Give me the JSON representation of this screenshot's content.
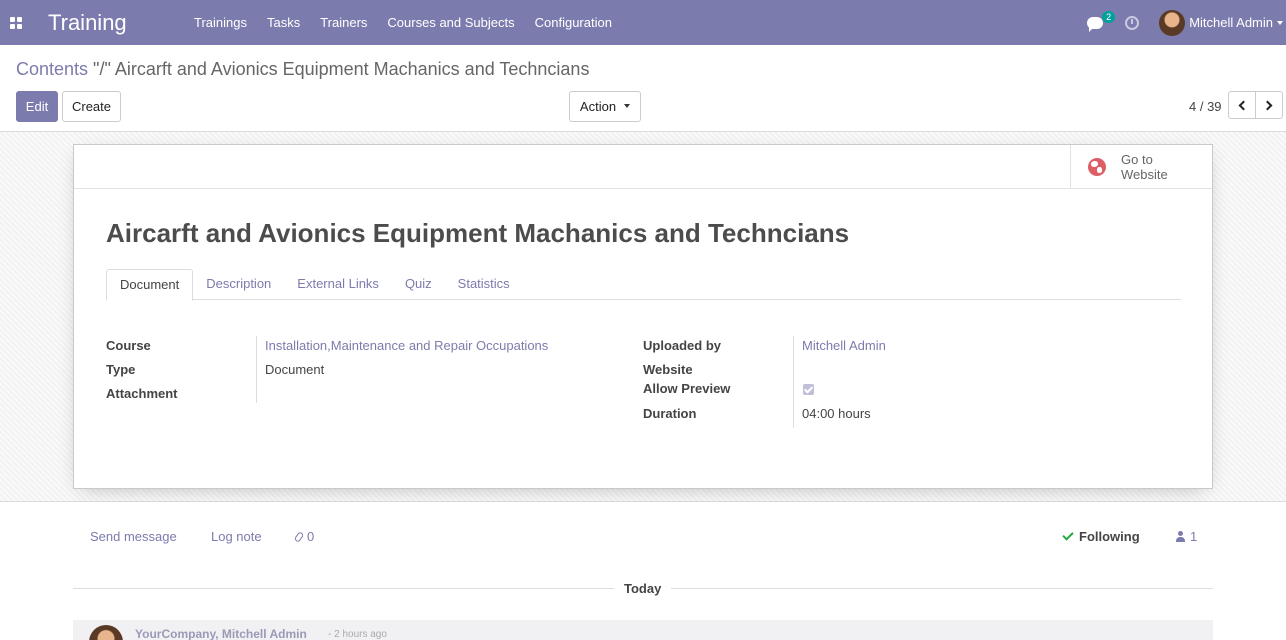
{
  "navbar": {
    "brand": "Training",
    "menu": [
      "Trainings",
      "Tasks",
      "Trainers",
      "Courses and Subjects",
      "Configuration"
    ],
    "chat_count": "2",
    "user_name": "Mitchell Admin"
  },
  "control_panel": {
    "breadcrumb_parent": "Contents",
    "breadcrumb_sep": " \"/\" ",
    "breadcrumb_current": "Aircarft and Avionics Equipment Machanics and Techncians",
    "edit_label": "Edit",
    "create_label": "Create",
    "action_label": "Action",
    "pager_value": "4 / 39"
  },
  "form": {
    "website_button": "Go to Website",
    "title": "Aircarft and Avionics Equipment Machanics and Techncians",
    "tabs": [
      "Document",
      "Description",
      "External Links",
      "Quiz",
      "Statistics"
    ],
    "left_fields": {
      "course_label": "Course",
      "course_value": "Installation,Maintenance and Repair Occupations",
      "type_label": "Type",
      "type_value": "Document",
      "attachment_label": "Attachment"
    },
    "right_fields": {
      "uploaded_by_label": "Uploaded by",
      "uploaded_by_value": "Mitchell Admin",
      "website_label": "Website",
      "allow_preview_label": "Allow Preview",
      "allow_preview_checked": true,
      "duration_label": "Duration",
      "duration_value": "04:00 hours"
    }
  },
  "chatter": {
    "send_message": "Send message",
    "log_note": "Log note",
    "attachments_count": "0",
    "following": "Following",
    "followers_count": "1",
    "today": "Today",
    "message_author": "YourCompany, Mitchell Admin",
    "message_time": "- 2 hours ago"
  },
  "colors": {
    "brand": "#7c7bad",
    "following_check": "#28a745",
    "globe": "#dc5f68"
  }
}
